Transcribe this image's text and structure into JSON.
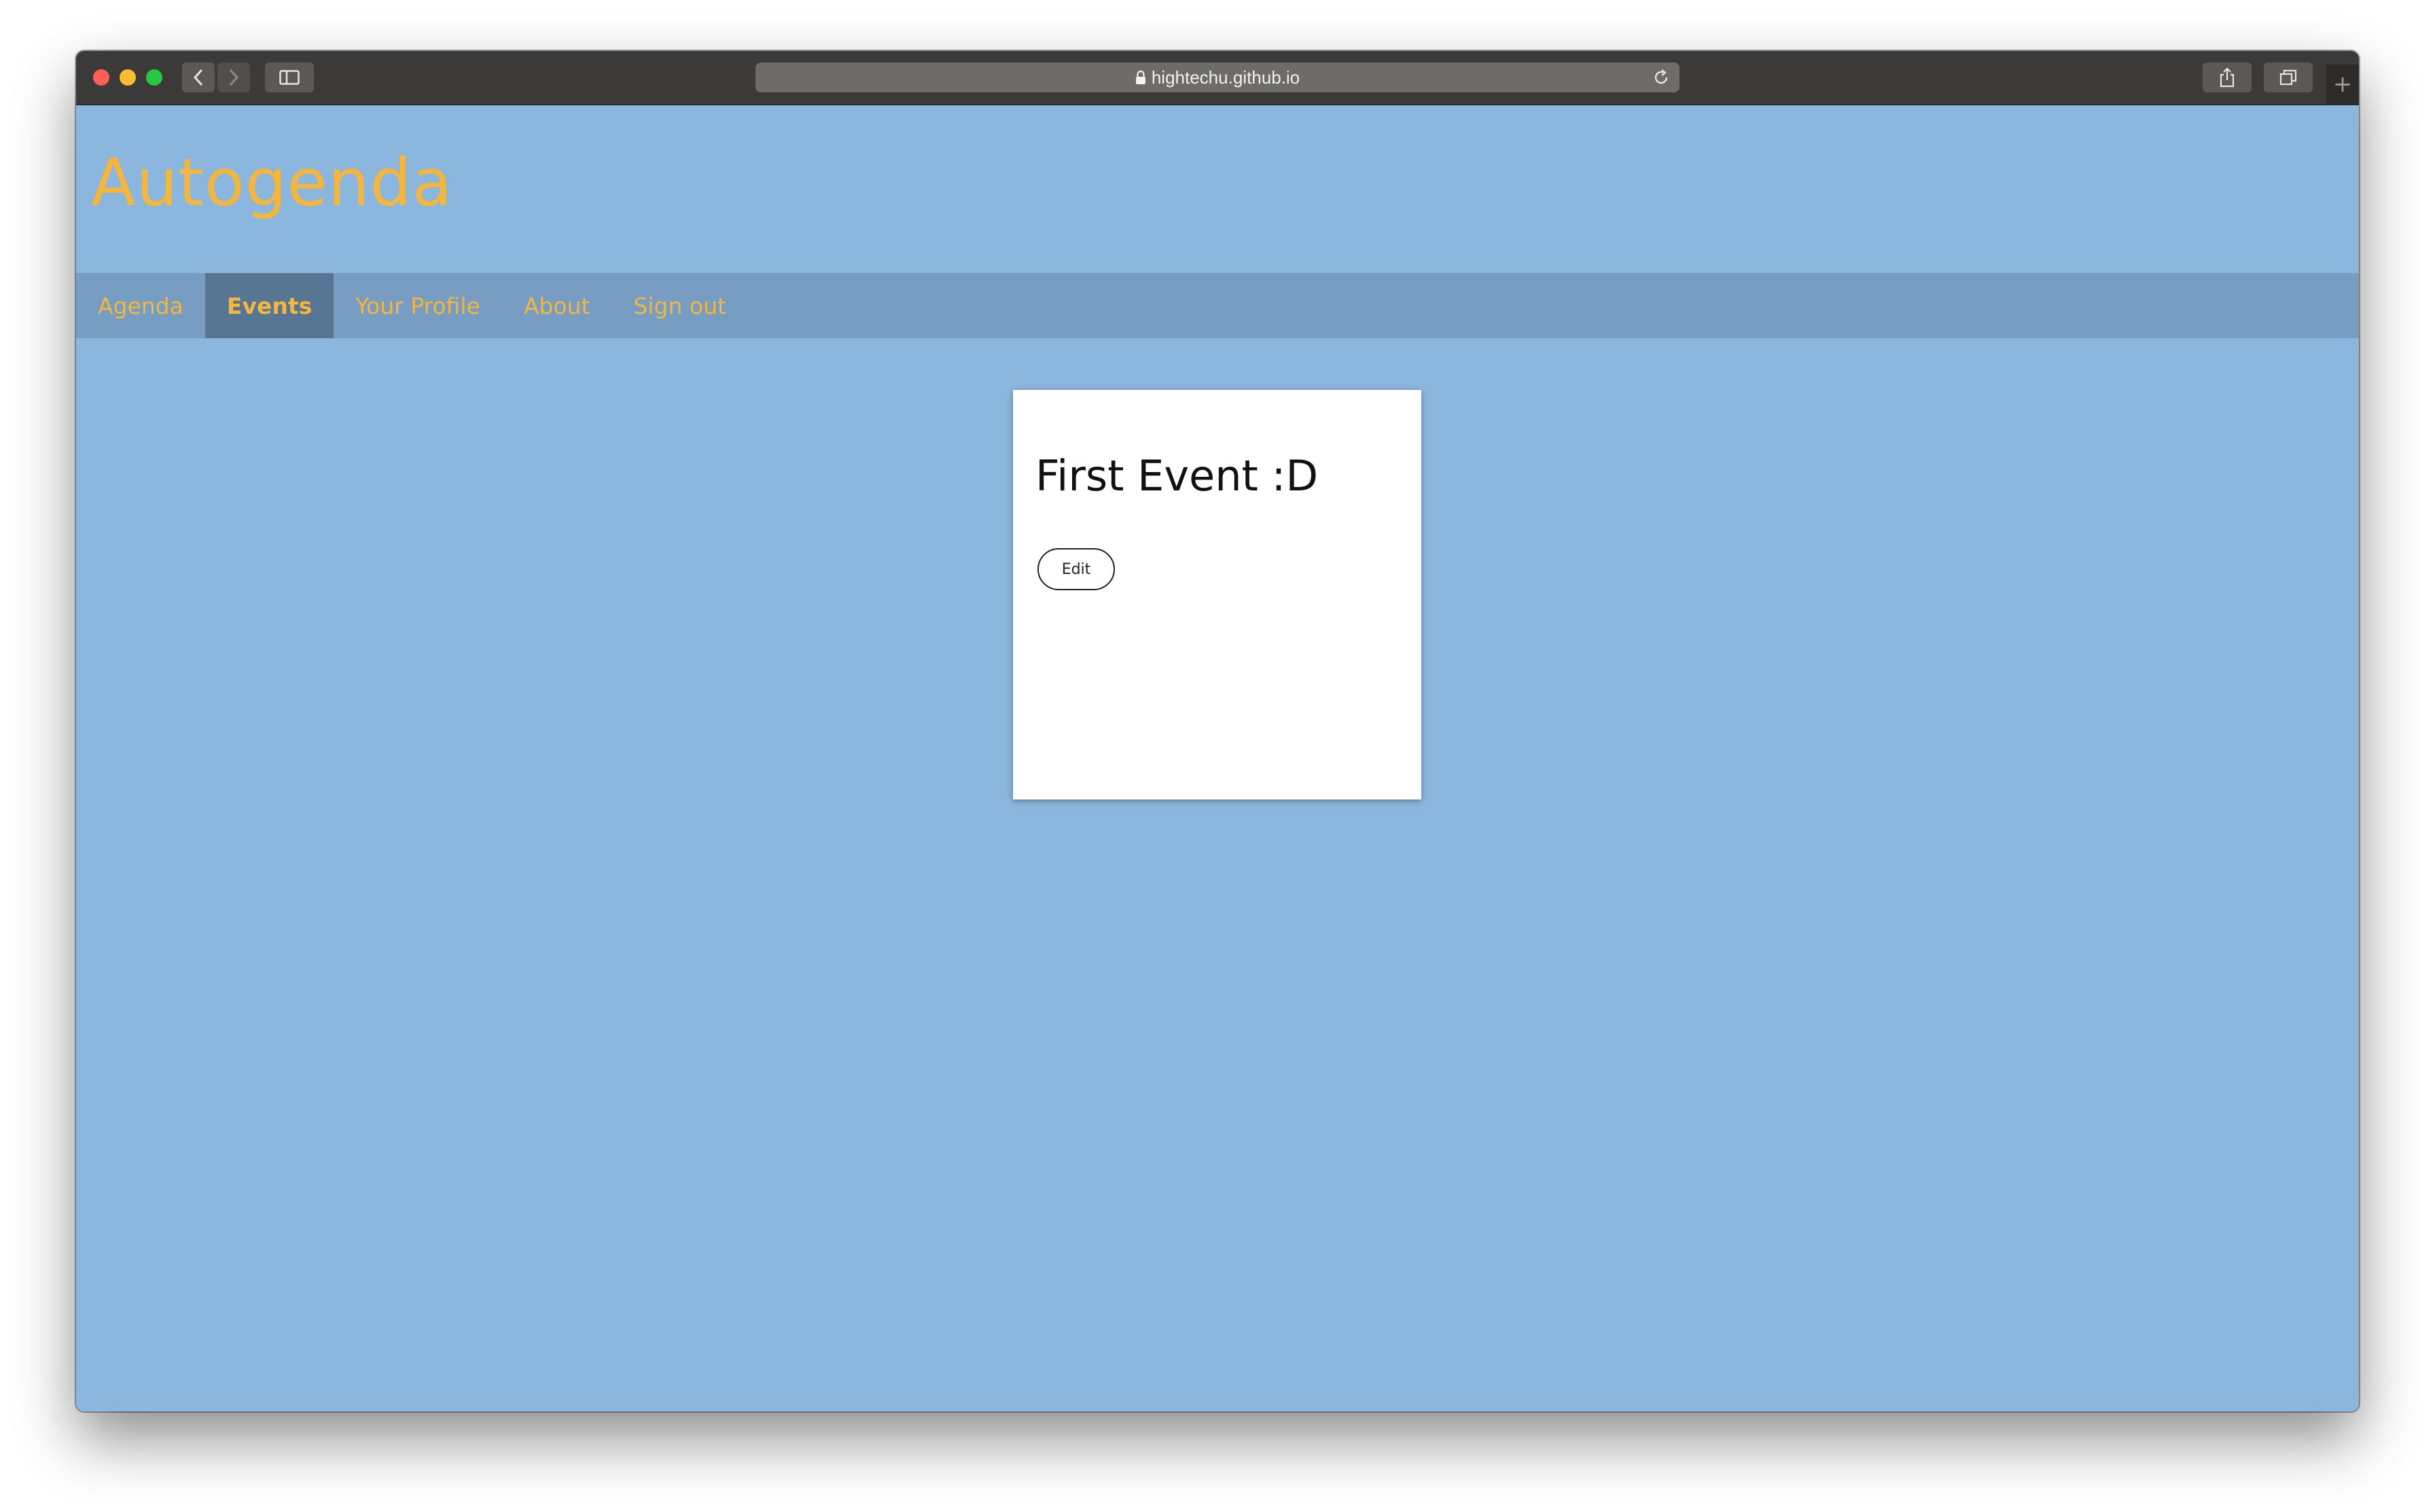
{
  "browser": {
    "url": "hightechu.github.io",
    "icons": {
      "back": "chevron-left-icon",
      "forward": "chevron-right-icon",
      "sidebar": "sidebar-icon",
      "lock": "lock-icon",
      "reload": "reload-icon",
      "share": "share-icon",
      "tabs": "tabs-icon",
      "new_tab": "plus-icon"
    },
    "new_tab_symbol": "+"
  },
  "site": {
    "title": "Autogenda",
    "colors": {
      "background": "#8bb6dd",
      "nav_bar": "#779dc3",
      "nav_active": "#577694",
      "accent": "#f4b63d"
    }
  },
  "nav": {
    "items": [
      {
        "label": "Agenda",
        "active": false
      },
      {
        "label": "Events",
        "active": true
      },
      {
        "label": "Your Profile",
        "active": false
      },
      {
        "label": "About",
        "active": false
      },
      {
        "label": "Sign out",
        "active": false
      }
    ]
  },
  "event_card": {
    "title": "First Event :D",
    "edit_label": "Edit"
  }
}
